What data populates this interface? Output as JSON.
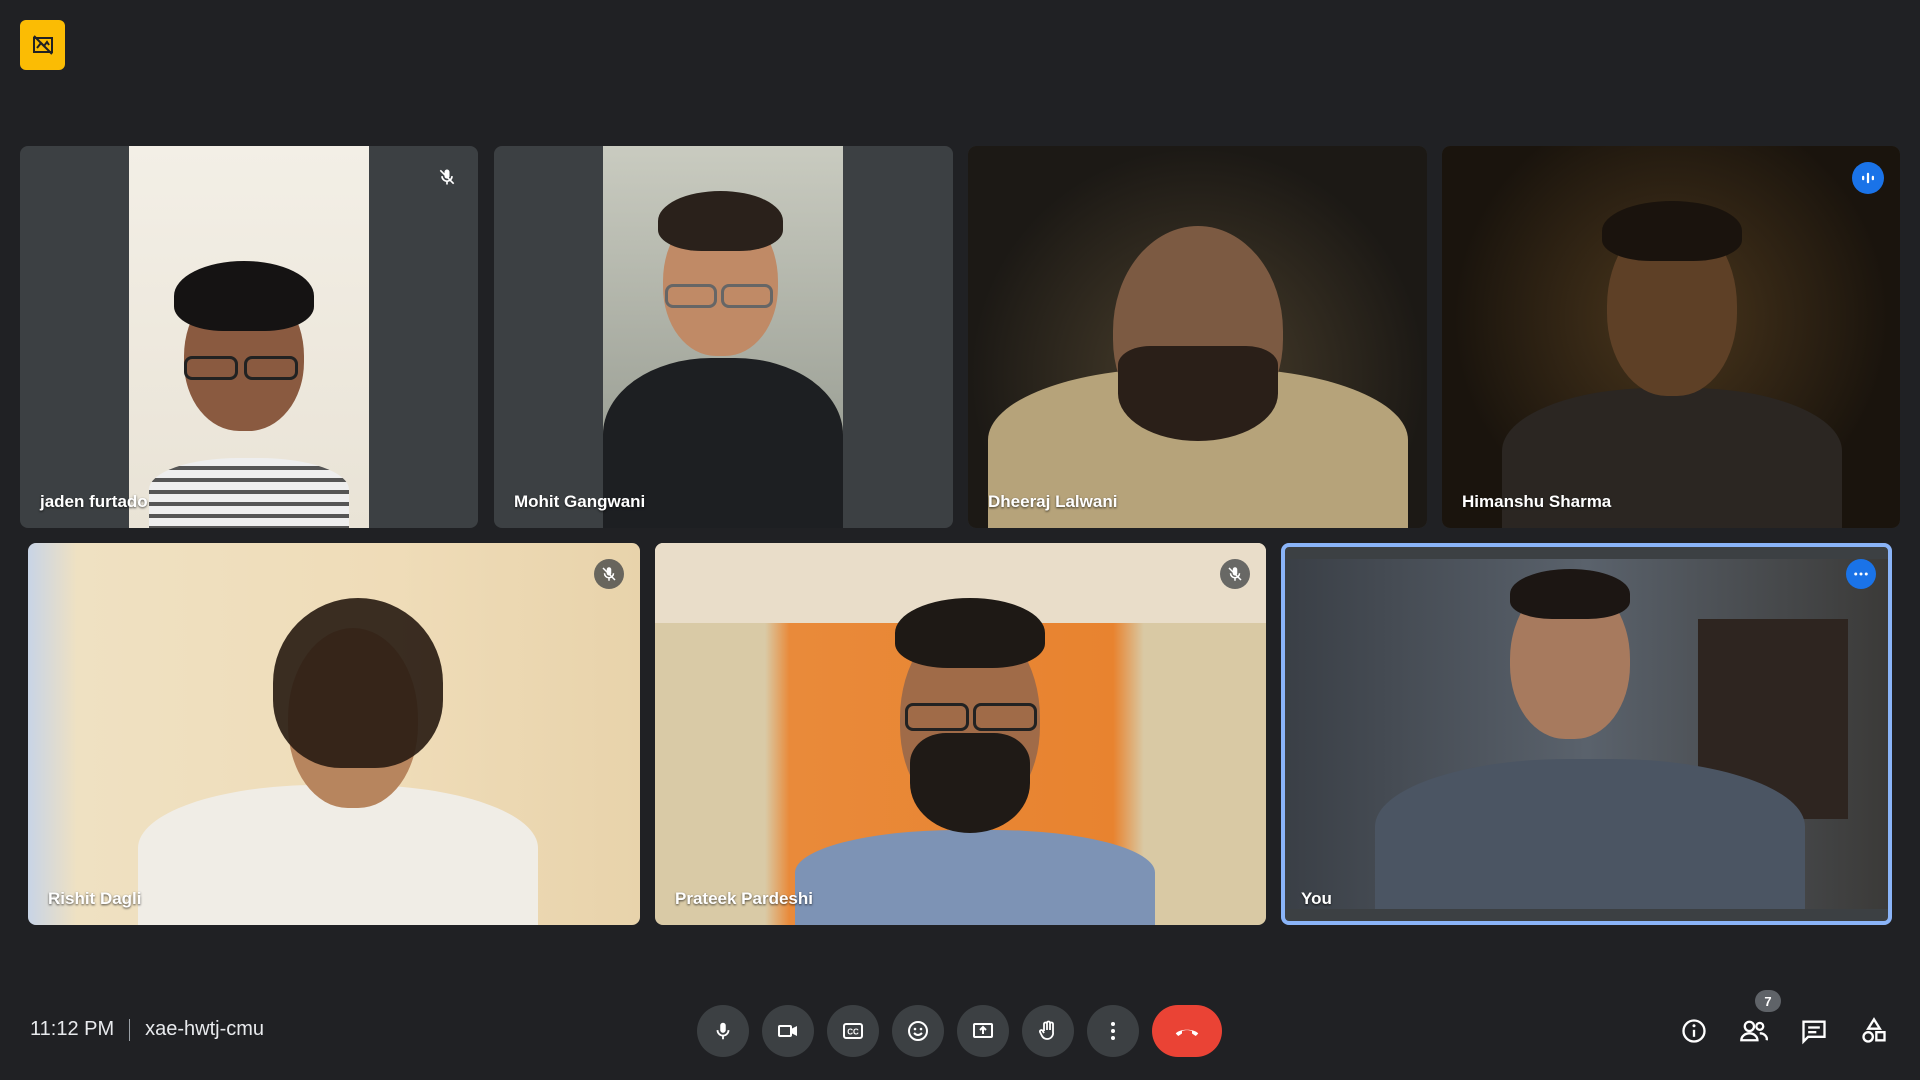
{
  "meeting": {
    "time": "11:12 PM",
    "code": "xae-hwtj-cmu",
    "participant_count": "7"
  },
  "participants": [
    {
      "name": "jaden furtado",
      "muted": true,
      "speaking": false
    },
    {
      "name": "Mohit Gangwani",
      "muted": false,
      "speaking": false
    },
    {
      "name": "Dheeraj Lalwani",
      "muted": false,
      "speaking": false
    },
    {
      "name": "Himanshu Sharma",
      "muted": false,
      "speaking": true
    },
    {
      "name": "Rishit Dagli",
      "muted": true,
      "speaking": false
    },
    {
      "name": "Prateek Pardeshi",
      "muted": true,
      "speaking": false
    },
    {
      "name": "You",
      "muted": false,
      "speaking": false,
      "self": true
    }
  ],
  "controls": {
    "mic": "microphone-icon",
    "camera": "camera-icon",
    "captions": "captions-icon",
    "reactions": "emoji-icon",
    "present": "present-screen-icon",
    "raise_hand": "raise-hand-icon",
    "more": "more-options-icon",
    "leave": "end-call-icon"
  },
  "right_controls": {
    "info": "info-icon",
    "people": "people-icon",
    "chat": "chat-icon",
    "activities": "activities-icon"
  },
  "colors": {
    "background": "#202124",
    "tile": "#3c4043",
    "accent_blue": "#1a73e8",
    "end_call": "#ea4335",
    "badge_yellow": "#fbbc04",
    "active_border": "#8ab4f8"
  }
}
